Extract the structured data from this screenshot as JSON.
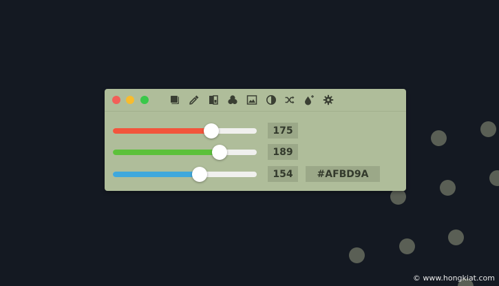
{
  "window": {
    "background_color": "#AFBD9A",
    "traffic_lights": [
      "#f25f58",
      "#f8bc2e",
      "#3ac84a"
    ],
    "toolbar_icons": [
      "square-shadow-icon",
      "eyedropper-icon",
      "palette-icon",
      "color-mix-icon",
      "image-icon",
      "contrast-icon",
      "shuffle-icon",
      "drop-add-icon",
      "gear-icon"
    ]
  },
  "sliders": [
    {
      "channel": "red",
      "value": 175,
      "max": 255,
      "color": "#f2553c"
    },
    {
      "channel": "green",
      "value": 189,
      "max": 255,
      "color": "#5cc13a"
    },
    {
      "channel": "blue",
      "value": 154,
      "max": 255,
      "color": "#3fa8dc"
    }
  ],
  "values": {
    "red": "175",
    "green": "189",
    "blue": "154"
  },
  "hex": "#AFBD9A",
  "watermark": "© www.hongkiat.com"
}
